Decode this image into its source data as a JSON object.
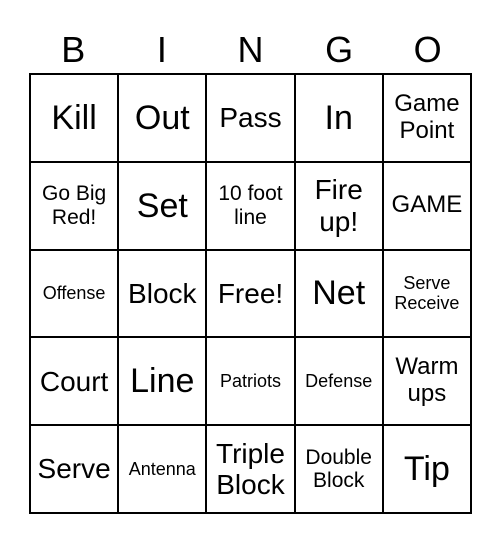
{
  "header": [
    "B",
    "I",
    "N",
    "G",
    "O"
  ],
  "cells": [
    [
      "Kill",
      "Out",
      "Pass",
      "In",
      "Game Point"
    ],
    [
      "Go Big Red!",
      "Set",
      "10 foot line",
      "Fire up!",
      "GAME"
    ],
    [
      "Offense",
      "Block",
      "Free!",
      "Net",
      "Serve Receive"
    ],
    [
      "Court",
      "Line",
      "Patriots",
      "Defense",
      "Warm ups"
    ],
    [
      "Serve",
      "Antenna",
      "Triple Block",
      "Double Block",
      "Tip"
    ]
  ]
}
